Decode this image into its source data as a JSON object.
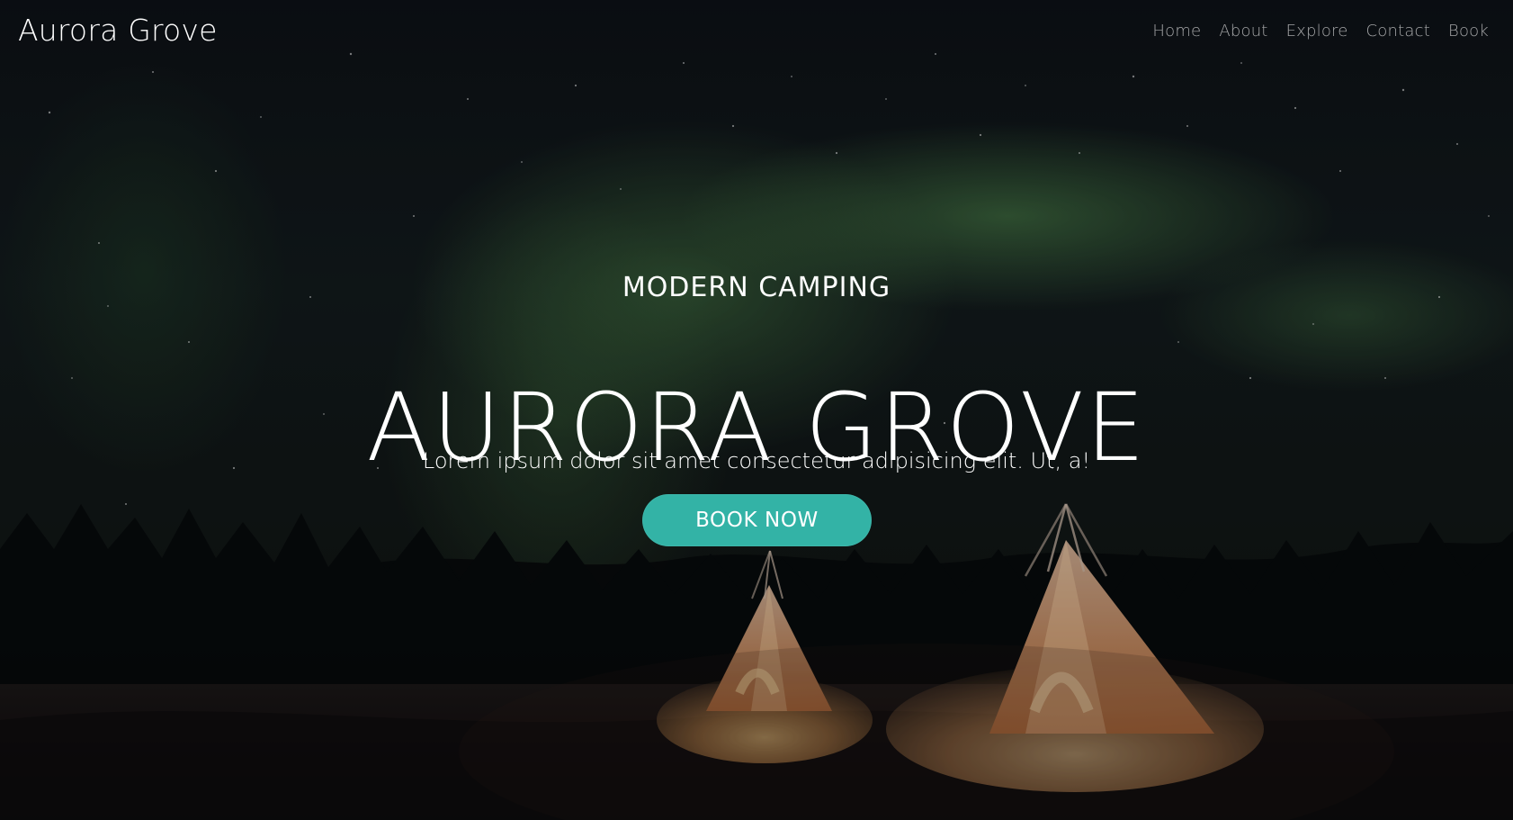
{
  "header": {
    "brand": "Aurora Grove",
    "nav": [
      {
        "label": "Home"
      },
      {
        "label": "About"
      },
      {
        "label": "Explore"
      },
      {
        "label": "Contact"
      },
      {
        "label": "Book"
      }
    ]
  },
  "hero": {
    "kicker": "MODERN CAMPING",
    "title": "AURORA GROVE",
    "subtitle": "Lorem ipsum dolor sit amet consectetur adipisicing elit. Ut, a!",
    "cta_label": "BOOK NOW"
  },
  "colors": {
    "accent": "#33b3a6",
    "text": "#ffffff"
  }
}
